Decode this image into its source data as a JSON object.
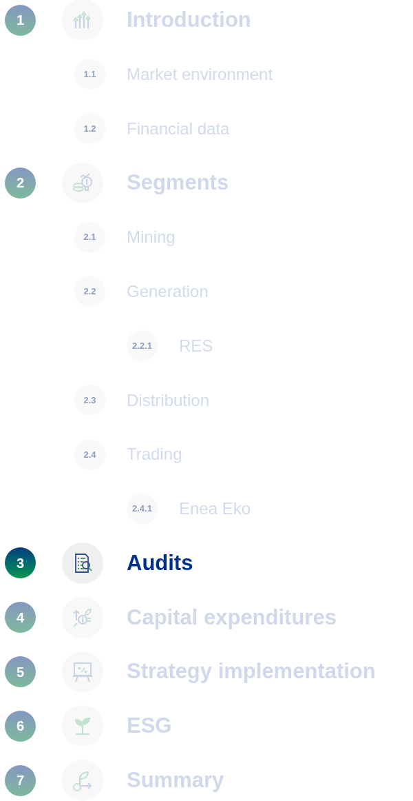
{
  "sections": [
    {
      "number": "1",
      "title": "Introduction",
      "selected": false,
      "children": [
        {
          "number": "1.1",
          "title": "Market environment",
          "selected": false
        },
        {
          "number": "1.2",
          "title": "Financial data",
          "selected": false
        }
      ]
    },
    {
      "number": "2",
      "title": "Segments",
      "selected": false,
      "children": [
        {
          "number": "2.1",
          "title": "Mining",
          "selected": false
        },
        {
          "number": "2.2",
          "title": "Generation",
          "selected": false,
          "children": [
            {
              "number": "2.2.1",
              "title": "RES",
              "selected": false
            }
          ]
        },
        {
          "number": "2.3",
          "title": "Distribution",
          "selected": false
        },
        {
          "number": "2.4",
          "title": "Trading",
          "selected": false,
          "children": [
            {
              "number": "2.4.1",
              "title": "Enea Eko",
              "selected": false
            }
          ]
        }
      ]
    },
    {
      "number": "3",
      "title": "Audits",
      "selected": true
    },
    {
      "number": "4",
      "title": "Capital expenditures",
      "selected": false
    },
    {
      "number": "5",
      "title": "Strategy implementation",
      "selected": false
    },
    {
      "number": "6",
      "title": "ESG",
      "selected": false
    },
    {
      "number": "7",
      "title": "Summary",
      "selected": false
    }
  ]
}
